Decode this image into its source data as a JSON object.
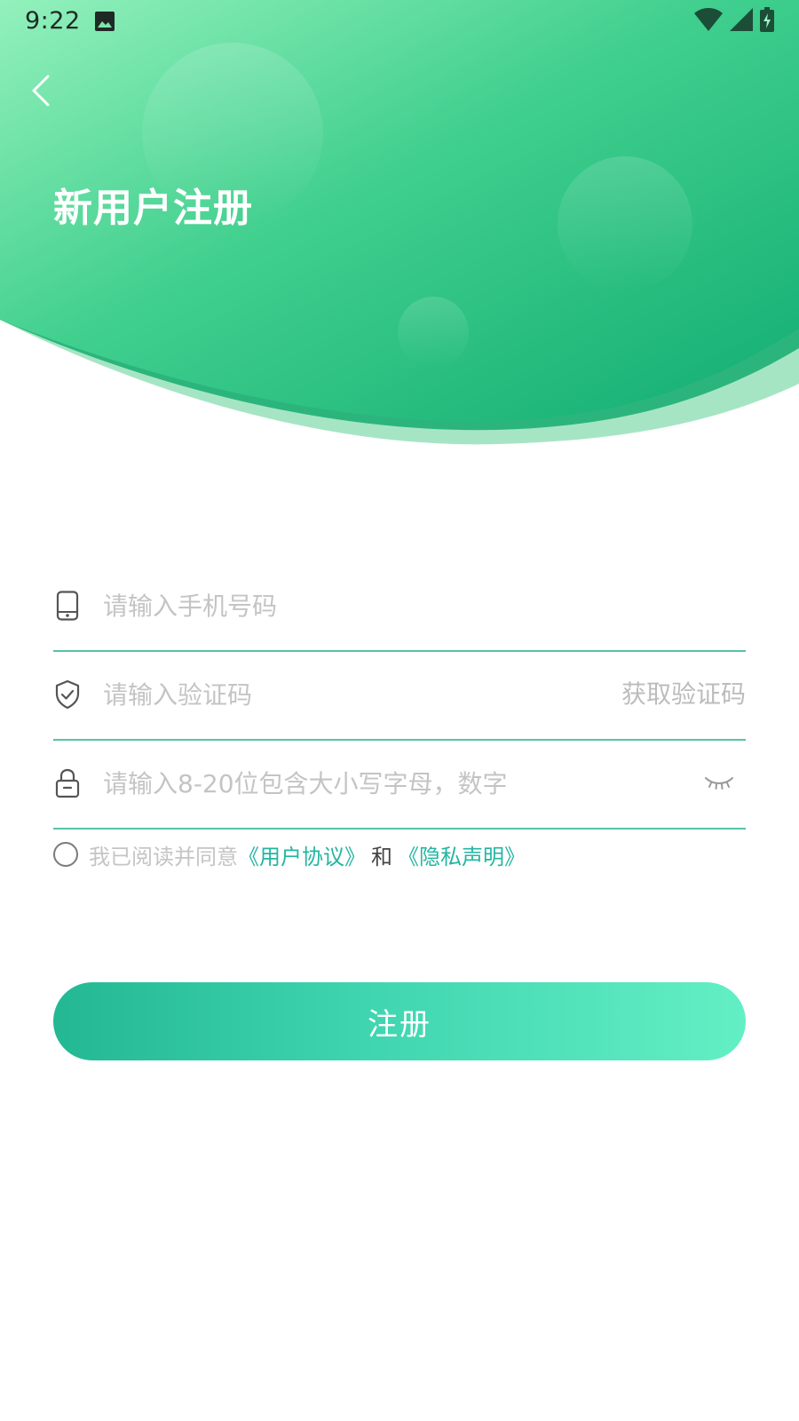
{
  "status_bar": {
    "time": "9:22"
  },
  "header": {
    "title": "新用户注册"
  },
  "form": {
    "phone": {
      "placeholder": "请输入手机号码",
      "value": ""
    },
    "code": {
      "placeholder": "请输入验证码",
      "value": "",
      "get_code_label": "获取验证码"
    },
    "password": {
      "placeholder": "请输入8-20位包含大小写字母，数字",
      "value": ""
    }
  },
  "agreement": {
    "prefix": "我已阅读并同意",
    "user_agreement": "《用户协议》",
    "and": "和",
    "privacy": "《隐私声明》",
    "checked": false
  },
  "register_button": {
    "label": "注册"
  },
  "icons": {
    "back": "chevron-left-icon",
    "phone": "phone-icon",
    "shield": "shield-check-icon",
    "lock": "lock-icon",
    "eye": "eye-closed-icon"
  },
  "colors": {
    "brand_green": "#2fc58c",
    "link": "#23b6a2",
    "underline": "#56c2a8"
  }
}
